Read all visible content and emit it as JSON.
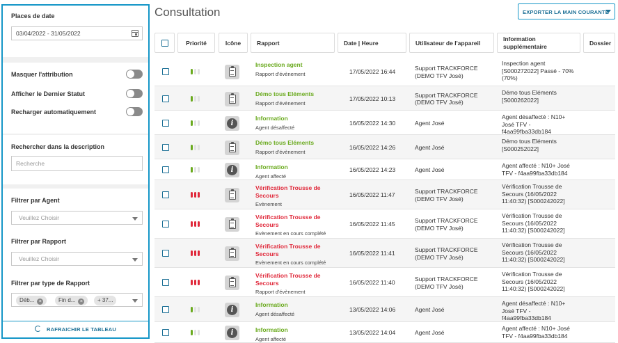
{
  "sidebar": {
    "date_label": "Places de date",
    "date_value": "03/04/2022 - 31/05/2022",
    "toggles": [
      {
        "label": "Masquer l'attribution"
      },
      {
        "label": "Afficher le Dernier Statut"
      },
      {
        "label": "Recharger automatiquement"
      }
    ],
    "search_label": "Rechercher dans la description",
    "search_placeholder": "Recherche",
    "agent_label": "Filtrer par Agent",
    "agent_value": "Veuillez Choisir",
    "rapport_label": "Filtrer par Rapport",
    "rapport_value": "Veuillez Choisir",
    "type_label": "Filtrer par type de Rapport",
    "type_chips": [
      "Déb...",
      "Fin d...",
      "+ 37..."
    ],
    "refresh_label": "RAFRAICHIR LE TABLEAU"
  },
  "header": {
    "title": "Consultation",
    "export_label": "EXPORTER LA MAIN COURANTE"
  },
  "table": {
    "columns": {
      "priority": "Priorité",
      "icon": "Icône",
      "report": "Rapport",
      "datetime": "Date | Heure",
      "user": "Utilisateur de l'appareil",
      "info": "Information supplémentaire",
      "folder": "Dossier"
    },
    "rows": [
      {
        "priority": "low",
        "icon": "clipboard-icon",
        "title": "Inspection agent",
        "color": "green",
        "sub": "Rapport d'évènement",
        "datetime": "17/05/2022 16:44",
        "user": "Support TRACKFORCE (DEMO TFV José)",
        "info": "Inspection agent [S000272022] Passé - 70% (70%)"
      },
      {
        "priority": "low",
        "icon": "clipboard-icon",
        "title": "Démo tous Eléments",
        "color": "green",
        "sub": "Rapport d'évènement",
        "datetime": "17/05/2022 10:13",
        "user": "Support TRACKFORCE (DEMO TFV José)",
        "info": "Démo tous Eléments [S000262022]"
      },
      {
        "priority": "low",
        "icon": "info-icon",
        "title": "Information",
        "color": "green",
        "sub": "Agent désaffecté",
        "datetime": "16/05/2022 14:30",
        "user": "Agent José",
        "info": "Agent désaffecté : N10+ José TFV - f4aa99fba33db184"
      },
      {
        "priority": "low",
        "icon": "clipboard-icon",
        "title": "Démo tous Eléments",
        "color": "green",
        "sub": "Rapport d'évènement",
        "datetime": "16/05/2022 14:26",
        "user": "Agent José",
        "info": "Démo tous Eléments [S000252022]"
      },
      {
        "priority": "low",
        "icon": "info-icon",
        "title": "Information",
        "color": "green",
        "sub": "Agent affecté",
        "datetime": "16/05/2022 14:23",
        "user": "Agent José",
        "info": "Agent affecté : N10+ José TFV - f4aa99fba33db184"
      },
      {
        "priority": "high",
        "icon": "clipboard-icon",
        "title": "Vérification Trousse de Secours",
        "color": "red",
        "sub": "Evènement",
        "datetime": "16/05/2022 11:47",
        "user": "Support TRACKFORCE (DEMO TFV José)",
        "info": "Vérification Trousse de Secours (16/05/2022 11:40:32) [S000242022]"
      },
      {
        "priority": "high",
        "icon": "clipboard-icon",
        "title": "Vérification Trousse de Secours",
        "color": "red",
        "sub": "Evènement en cours complété",
        "datetime": "16/05/2022 11:45",
        "user": "Support TRACKFORCE (DEMO TFV José)",
        "info": "Vérification Trousse de Secours (16/05/2022 11:40:32) [S000242022]"
      },
      {
        "priority": "high",
        "icon": "clipboard-icon",
        "title": "Vérification Trousse de Secours",
        "color": "red",
        "sub": "Evènement en cours complété",
        "datetime": "16/05/2022 11:41",
        "user": "Support TRACKFORCE (DEMO TFV José)",
        "info": "Vérification Trousse de Secours (16/05/2022 11:40:32) [S000242022]"
      },
      {
        "priority": "high",
        "icon": "clipboard-icon",
        "title": "Vérification Trousse de Secours",
        "color": "red",
        "sub": "Rapport d'évènement",
        "datetime": "16/05/2022 11:40",
        "user": "Support TRACKFORCE (DEMO TFV José)",
        "info": "Vérification Trousse de Secours (16/05/2022 11:40:32) [S000242022]"
      },
      {
        "priority": "low",
        "icon": "info-icon",
        "title": "Information",
        "color": "green",
        "sub": "Agent désaffecté",
        "datetime": "13/05/2022 14:06",
        "user": "Agent José",
        "info": "Agent désaffecté : N10+ José TFV - f4aa99fba33db184"
      },
      {
        "priority": "low",
        "icon": "info-icon",
        "title": "Information",
        "color": "green",
        "sub": "Agent affecté",
        "datetime": "13/05/2022 14:04",
        "user": "Agent José",
        "info": "Agent affecté : N10+ José TFV - f4aa99fba33db184"
      }
    ]
  },
  "colors": {
    "accent": "#1596c7",
    "green": "#6aaa1e",
    "red": "#e0283a"
  }
}
